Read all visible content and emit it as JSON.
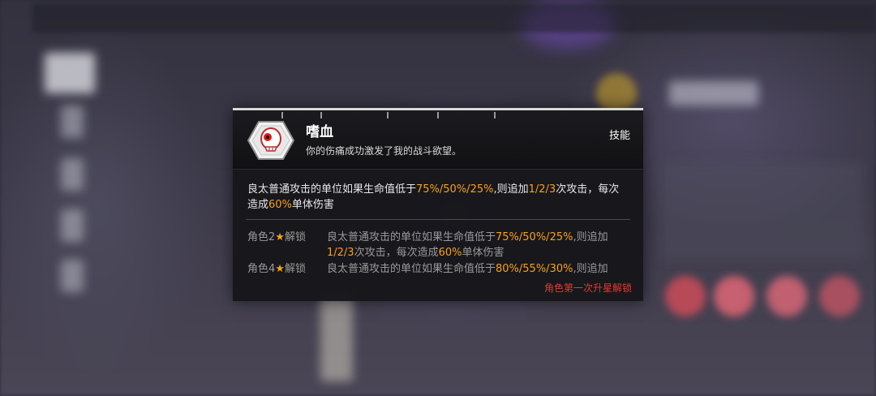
{
  "skill": {
    "name": "嗜血",
    "flavor": "你的伤痛成功激发了我的战斗欲望。",
    "type_label": "技能",
    "icon": "skull-hexagon-icon"
  },
  "description": {
    "parts": [
      {
        "text": "良太普通攻击的单位如果生命值低于",
        "hl": false
      },
      {
        "text": "75%/50%/25%",
        "hl": true
      },
      {
        "text": ",则追加",
        "hl": false
      },
      {
        "text": "1/2/3",
        "hl": true
      },
      {
        "text": "次攻击，每次造成",
        "hl": false
      },
      {
        "text": "60%",
        "hl": true
      },
      {
        "text": "单体伤害",
        "hl": false
      }
    ]
  },
  "upgrades": [
    {
      "label_prefix": "角色",
      "stars": "2",
      "star_glyph": "★",
      "label_suffix": "解锁",
      "parts": [
        {
          "text": "良太普通攻击的单位如果生命值低于",
          "hl": false
        },
        {
          "text": "75%/50%/25%",
          "hl": true
        },
        {
          "text": ",则追加",
          "hl": false
        },
        {
          "text": "1/2/3",
          "hl": true
        },
        {
          "text": "次攻击，每次造成",
          "hl": false
        },
        {
          "text": "60%",
          "hl": true
        },
        {
          "text": "单体伤害",
          "hl": false
        }
      ]
    },
    {
      "label_prefix": "角色",
      "stars": "4",
      "star_glyph": "★",
      "label_suffix": "解锁",
      "parts": [
        {
          "text": "良太普通攻击的单位如果生命值低于",
          "hl": false
        },
        {
          "text": "80%/55%/30%",
          "hl": true
        },
        {
          "text": ",则追加",
          "hl": false
        }
      ]
    }
  ],
  "unlock_note": "角色第一次升星解锁",
  "colors": {
    "highlight": "#f6a21e",
    "unlock_red": "#e33b2e",
    "panel_bg": "#16161a"
  }
}
